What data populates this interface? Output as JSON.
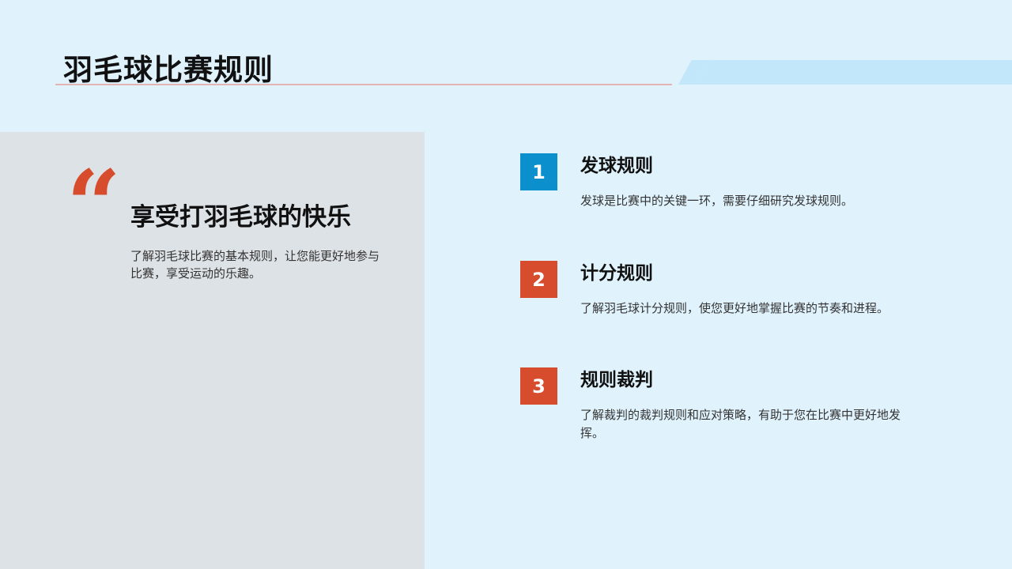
{
  "page": {
    "title": "羽毛球比赛规则"
  },
  "colors": {
    "background": "#e0f3fd",
    "panel": "#dde2e6",
    "accent_red": "#d64c2d",
    "accent_blue": "#0b8fcd",
    "deco": "#c3e7fa"
  },
  "quote": {
    "icon": "quote-mark-icon",
    "glyph": "“",
    "heading": "享受打羽毛球的快乐",
    "description": "了解羽毛球比赛的基本规则，让您能更好地参与比赛，享受运动的乐趣。"
  },
  "items": [
    {
      "number": "1",
      "title": "发球规则",
      "description": "发球是比赛中的关键一环，需要仔细研究发球规则。",
      "badge_color": "#0b8fcd"
    },
    {
      "number": "2",
      "title": "计分规则",
      "description": "了解羽毛球计分规则，使您更好地掌握比赛的节奏和进程。",
      "badge_color": "#d64c2d"
    },
    {
      "number": "3",
      "title": "规则裁判",
      "description": "了解裁判的裁判规则和应对策略，有助于您在比赛中更好地发挥。",
      "badge_color": "#d64c2d"
    }
  ]
}
